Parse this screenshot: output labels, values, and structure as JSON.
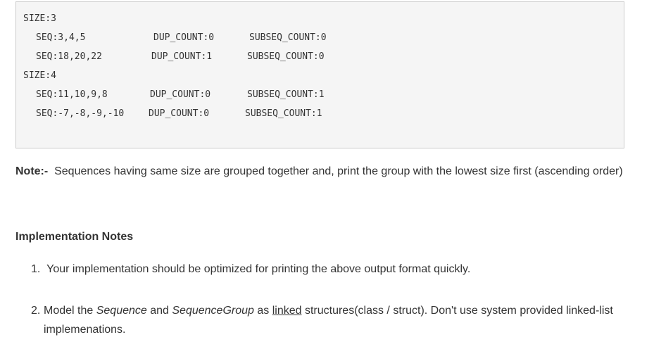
{
  "code": {
    "lines": [
      {
        "c1": "SIZE:3"
      },
      {
        "c1": "SEQ:3,4,5",
        "c2": "DUP_COUNT:0",
        "c3": "SUBSEQ_COUNT:0"
      },
      {
        "c1": "SEQ:18,20,22",
        "c2": "DUP_COUNT:1",
        "c3": "SUBSEQ_COUNT:0"
      },
      {
        "c1": "SIZE:4"
      },
      {
        "c1": "SEQ:11,10,9,8",
        "c2": "DUP_COUNT:0",
        "c3": "SUBSEQ_COUNT:1"
      },
      {
        "c1": "SEQ:-7,-8,-9,-10",
        "c2": "DUP_COUNT:0",
        "c3": "SUBSEQ_COUNT:1"
      }
    ]
  },
  "note": {
    "label": "Note:-",
    "text": "Sequences having same size are grouped together and, print the group with the lowest size first (ascending order)"
  },
  "implementation": {
    "heading": "Implementation Notes",
    "items": [
      {
        "number": "1.",
        "text": "Your implementation should be optimized for printing the above output format quickly."
      },
      {
        "number": "2.",
        "part1": "Model the ",
        "em1": "Sequence",
        "part2": " and ",
        "em2": "SequenceGroup",
        "part3": " as ",
        "link": "linked",
        "part4": " structures(class / struct).  Don't use system provided linked-list implemenations."
      }
    ]
  }
}
